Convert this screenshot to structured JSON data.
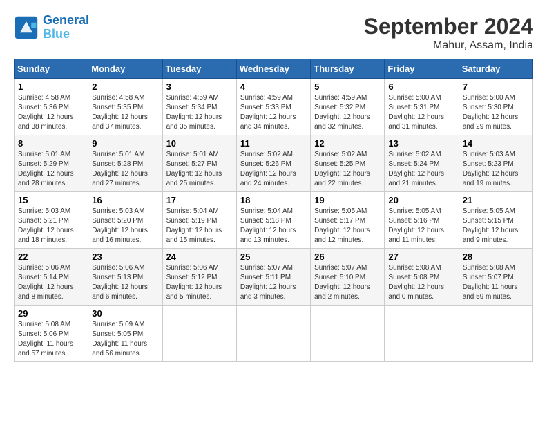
{
  "header": {
    "logo_line1": "General",
    "logo_line2": "Blue",
    "month": "September 2024",
    "location": "Mahur, Assam, India"
  },
  "weekdays": [
    "Sunday",
    "Monday",
    "Tuesday",
    "Wednesday",
    "Thursday",
    "Friday",
    "Saturday"
  ],
  "weeks": [
    [
      {
        "num": "1",
        "sunrise": "4:58 AM",
        "sunset": "5:36 PM",
        "daylight": "12 hours and 38 minutes."
      },
      {
        "num": "2",
        "sunrise": "4:58 AM",
        "sunset": "5:35 PM",
        "daylight": "12 hours and 37 minutes."
      },
      {
        "num": "3",
        "sunrise": "4:59 AM",
        "sunset": "5:34 PM",
        "daylight": "12 hours and 35 minutes."
      },
      {
        "num": "4",
        "sunrise": "4:59 AM",
        "sunset": "5:33 PM",
        "daylight": "12 hours and 34 minutes."
      },
      {
        "num": "5",
        "sunrise": "4:59 AM",
        "sunset": "5:32 PM",
        "daylight": "12 hours and 32 minutes."
      },
      {
        "num": "6",
        "sunrise": "5:00 AM",
        "sunset": "5:31 PM",
        "daylight": "12 hours and 31 minutes."
      },
      {
        "num": "7",
        "sunrise": "5:00 AM",
        "sunset": "5:30 PM",
        "daylight": "12 hours and 29 minutes."
      }
    ],
    [
      {
        "num": "8",
        "sunrise": "5:01 AM",
        "sunset": "5:29 PM",
        "daylight": "12 hours and 28 minutes."
      },
      {
        "num": "9",
        "sunrise": "5:01 AM",
        "sunset": "5:28 PM",
        "daylight": "12 hours and 27 minutes."
      },
      {
        "num": "10",
        "sunrise": "5:01 AM",
        "sunset": "5:27 PM",
        "daylight": "12 hours and 25 minutes."
      },
      {
        "num": "11",
        "sunrise": "5:02 AM",
        "sunset": "5:26 PM",
        "daylight": "12 hours and 24 minutes."
      },
      {
        "num": "12",
        "sunrise": "5:02 AM",
        "sunset": "5:25 PM",
        "daylight": "12 hours and 22 minutes."
      },
      {
        "num": "13",
        "sunrise": "5:02 AM",
        "sunset": "5:24 PM",
        "daylight": "12 hours and 21 minutes."
      },
      {
        "num": "14",
        "sunrise": "5:03 AM",
        "sunset": "5:23 PM",
        "daylight": "12 hours and 19 minutes."
      }
    ],
    [
      {
        "num": "15",
        "sunrise": "5:03 AM",
        "sunset": "5:21 PM",
        "daylight": "12 hours and 18 minutes."
      },
      {
        "num": "16",
        "sunrise": "5:03 AM",
        "sunset": "5:20 PM",
        "daylight": "12 hours and 16 minutes."
      },
      {
        "num": "17",
        "sunrise": "5:04 AM",
        "sunset": "5:19 PM",
        "daylight": "12 hours and 15 minutes."
      },
      {
        "num": "18",
        "sunrise": "5:04 AM",
        "sunset": "5:18 PM",
        "daylight": "12 hours and 13 minutes."
      },
      {
        "num": "19",
        "sunrise": "5:05 AM",
        "sunset": "5:17 PM",
        "daylight": "12 hours and 12 minutes."
      },
      {
        "num": "20",
        "sunrise": "5:05 AM",
        "sunset": "5:16 PM",
        "daylight": "12 hours and 11 minutes."
      },
      {
        "num": "21",
        "sunrise": "5:05 AM",
        "sunset": "5:15 PM",
        "daylight": "12 hours and 9 minutes."
      }
    ],
    [
      {
        "num": "22",
        "sunrise": "5:06 AM",
        "sunset": "5:14 PM",
        "daylight": "12 hours and 8 minutes."
      },
      {
        "num": "23",
        "sunrise": "5:06 AM",
        "sunset": "5:13 PM",
        "daylight": "12 hours and 6 minutes."
      },
      {
        "num": "24",
        "sunrise": "5:06 AM",
        "sunset": "5:12 PM",
        "daylight": "12 hours and 5 minutes."
      },
      {
        "num": "25",
        "sunrise": "5:07 AM",
        "sunset": "5:11 PM",
        "daylight": "12 hours and 3 minutes."
      },
      {
        "num": "26",
        "sunrise": "5:07 AM",
        "sunset": "5:10 PM",
        "daylight": "12 hours and 2 minutes."
      },
      {
        "num": "27",
        "sunrise": "5:08 AM",
        "sunset": "5:08 PM",
        "daylight": "12 hours and 0 minutes."
      },
      {
        "num": "28",
        "sunrise": "5:08 AM",
        "sunset": "5:07 PM",
        "daylight": "11 hours and 59 minutes."
      }
    ],
    [
      {
        "num": "29",
        "sunrise": "5:08 AM",
        "sunset": "5:06 PM",
        "daylight": "11 hours and 57 minutes."
      },
      {
        "num": "30",
        "sunrise": "5:09 AM",
        "sunset": "5:05 PM",
        "daylight": "11 hours and 56 minutes."
      },
      null,
      null,
      null,
      null,
      null
    ]
  ]
}
